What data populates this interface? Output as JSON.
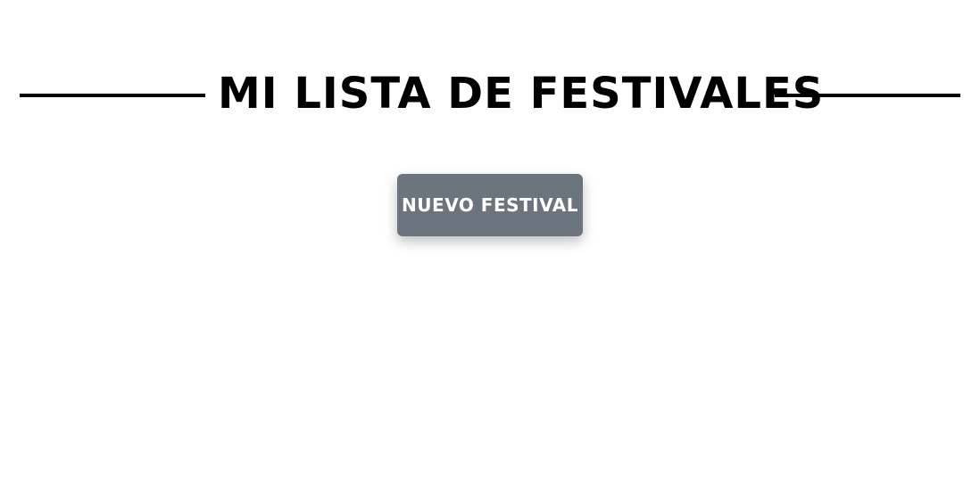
{
  "page": {
    "title": "Mi lista de festivales",
    "new_festival_button": "Nuevo festival"
  },
  "colors": {
    "background": "#ffffff",
    "title": "#000000",
    "button": "#6c757d",
    "button_text": "#ffffff"
  }
}
